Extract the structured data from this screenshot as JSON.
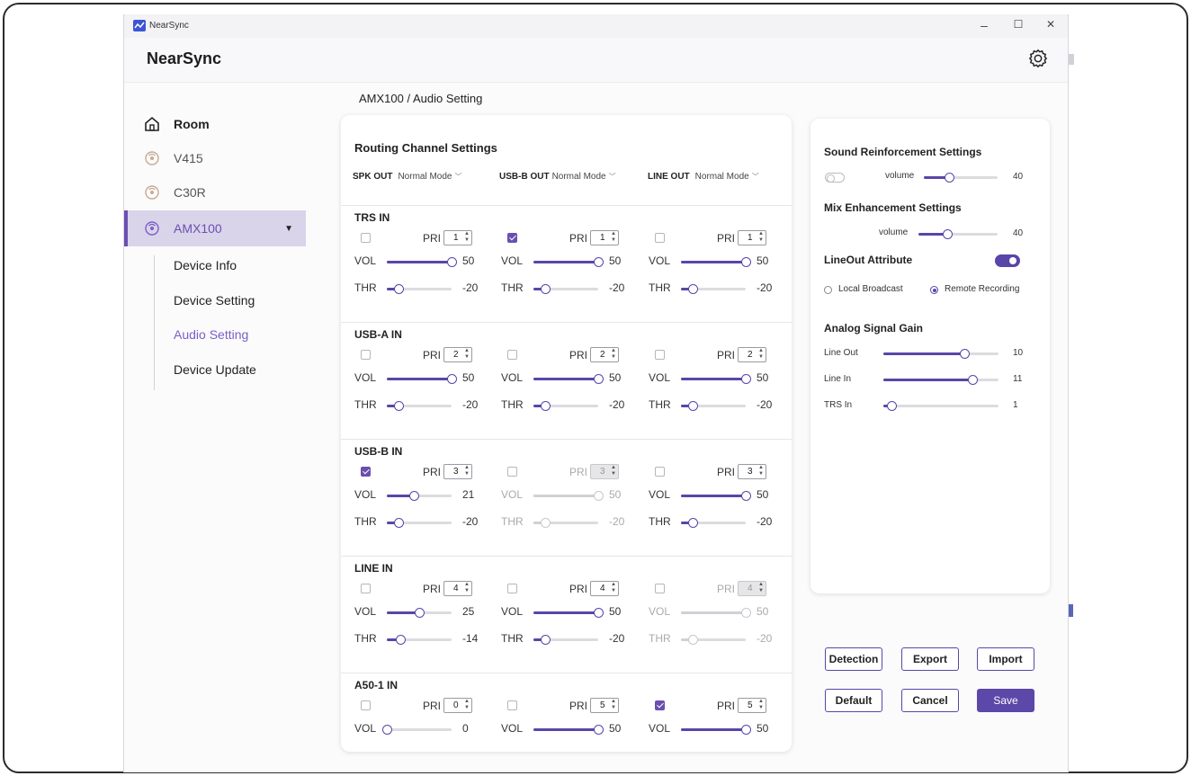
{
  "window": {
    "titlebar_title": "NearSync",
    "minimize": "–",
    "maximize": "☐",
    "close": "✕"
  },
  "header": {
    "title": "NearSync"
  },
  "sidebar": {
    "items": [
      {
        "label": "Room",
        "icon": "home-icon"
      },
      {
        "label": "V415",
        "icon": "wireless-device-icon"
      },
      {
        "label": "C30R",
        "icon": "wireless-device-icon"
      },
      {
        "label": "AMX100",
        "icon": "wireless-device-icon",
        "active": true
      }
    ],
    "subitems": [
      "Device Info",
      "Device Setting",
      "Audio Setting",
      "Device Update"
    ],
    "active_subitem": "Audio Setting"
  },
  "breadcrumb": "AMX100 / Audio Setting",
  "routing": {
    "title": "Routing Channel Settings",
    "outputs": [
      {
        "name": "SPK OUT",
        "mode": "Normal Mode"
      },
      {
        "name": "USB-B OUT",
        "mode": "Normal Mode"
      },
      {
        "name": "LINE OUT",
        "mode": "Normal Mode"
      }
    ],
    "labels": {
      "pri": "PRI",
      "vol": "VOL",
      "thr": "THR"
    },
    "inputs": [
      {
        "name": "TRS IN",
        "channels": [
          {
            "checked": false,
            "pri": "1",
            "vol": 50,
            "thr": -20,
            "disabled": false
          },
          {
            "checked": true,
            "pri": "1",
            "vol": 50,
            "thr": -20,
            "disabled": false
          },
          {
            "checked": false,
            "pri": "1",
            "vol": 50,
            "thr": -20,
            "disabled": false
          }
        ]
      },
      {
        "name": "USB-A IN",
        "channels": [
          {
            "checked": false,
            "pri": "2",
            "vol": 50,
            "thr": -20,
            "disabled": false
          },
          {
            "checked": false,
            "pri": "2",
            "vol": 50,
            "thr": -20,
            "disabled": false
          },
          {
            "checked": false,
            "pri": "2",
            "vol": 50,
            "thr": -20,
            "disabled": false
          }
        ]
      },
      {
        "name": "USB-B IN",
        "channels": [
          {
            "checked": true,
            "pri": "3",
            "vol": 21,
            "thr": -20,
            "disabled": false
          },
          {
            "checked": false,
            "pri": "3",
            "vol": 50,
            "thr": -20,
            "disabled": true
          },
          {
            "checked": false,
            "pri": "3",
            "vol": 50,
            "thr": -20,
            "disabled": false
          }
        ]
      },
      {
        "name": "LINE IN",
        "channels": [
          {
            "checked": false,
            "pri": "4",
            "vol": 25,
            "thr": -14,
            "disabled": false
          },
          {
            "checked": false,
            "pri": "4",
            "vol": 50,
            "thr": -20,
            "disabled": false
          },
          {
            "checked": false,
            "pri": "4",
            "vol": 50,
            "thr": -20,
            "disabled": true
          }
        ]
      },
      {
        "name": "A50-1 IN",
        "channels": [
          {
            "checked": false,
            "pri": "0",
            "vol": 0,
            "disabled": false
          },
          {
            "checked": false,
            "pri": "5",
            "vol": 50,
            "disabled": false
          },
          {
            "checked": true,
            "pri": "5",
            "vol": 50,
            "disabled": false
          }
        ]
      }
    ]
  },
  "right_panel": {
    "sound_reinforcement": {
      "title": "Sound Reinforcement Settings",
      "enabled": false,
      "volume_label": "volume",
      "volume": 40
    },
    "mix_enhancement": {
      "title": "Mix Enhancement Settings",
      "volume_label": "volume",
      "volume": 40
    },
    "lineout_attribute": {
      "title": "LineOut Attribute",
      "enabled": true,
      "options": [
        "Local Broadcast",
        "Remote Recording"
      ],
      "selected": "Remote Recording"
    },
    "analog_gain": {
      "title": "Analog Signal Gain",
      "rows": [
        {
          "label": "Line Out",
          "value": 10,
          "level": 0.7
        },
        {
          "label": "Line In",
          "value": 11,
          "level": 0.77
        },
        {
          "label": "TRS In",
          "value": 1,
          "level": 0.07
        }
      ]
    }
  },
  "buttons": {
    "detection": "Detection",
    "export": "Export",
    "import": "Import",
    "default": "Default",
    "cancel": "Cancel",
    "save": "Save"
  },
  "colors": {
    "accent": "#5a45a8",
    "active_nav_bg": "#d9d4ea",
    "active_sub": "#7b5fc6"
  }
}
